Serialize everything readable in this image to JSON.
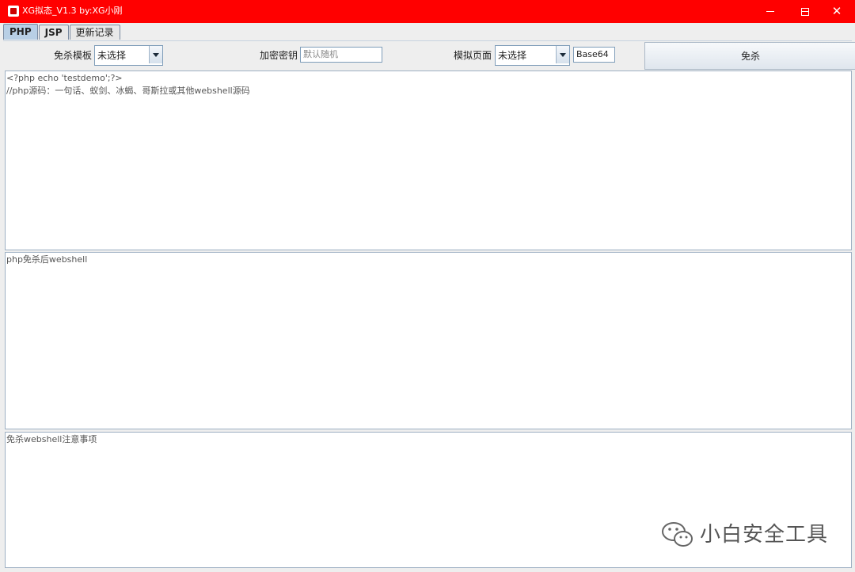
{
  "window": {
    "title": "XG拟态_V1.3   by:XG小刚",
    "controls": [
      "minimize-icon",
      "maximize-icon",
      "close-icon"
    ]
  },
  "tabs": [
    {
      "label": "PHP",
      "active": true
    },
    {
      "label": "JSP",
      "active": false
    },
    {
      "label": "更新记录",
      "active": false
    }
  ],
  "toolbar": {
    "template_label": "免杀模板",
    "template_value": "未选择",
    "key_label": "加密密钥",
    "key_placeholder": "默认随机",
    "page_label": "模拟页面",
    "page_value": "未选择",
    "encoding_value": "Base64",
    "run_label": "免杀"
  },
  "areas": {
    "source_line1": "<?php echo 'testdemo';?>",
    "source_line2": "//php源码：一句话、蚁剑、冰蝎、哥斯拉或其他webshell源码",
    "output_text": "php免杀后webshell",
    "notes_text": "免杀webshell注意事项"
  },
  "watermark": {
    "text": "小白安全工具",
    "icon": "wechat-icon"
  },
  "colors": {
    "titlebar": "#ff0000",
    "tab_active": "#b8cfe5"
  }
}
